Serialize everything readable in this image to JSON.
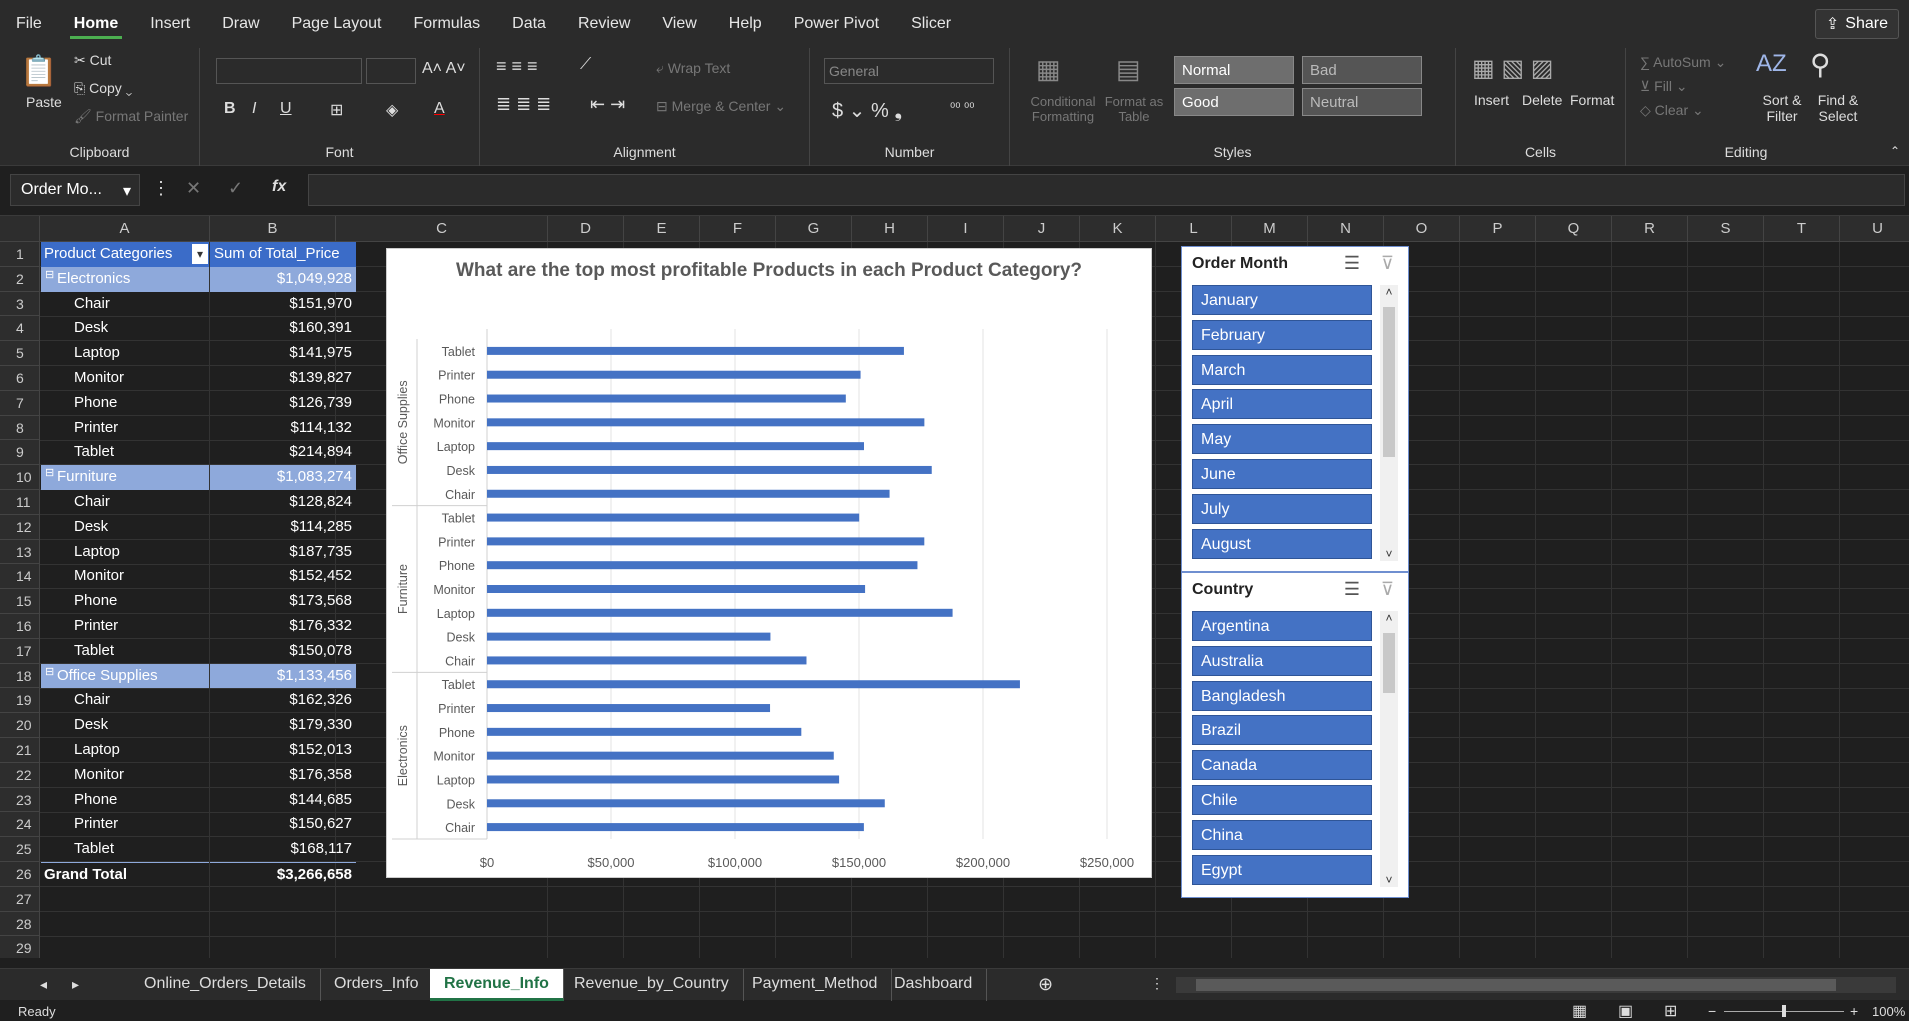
{
  "menu": {
    "items": [
      "File",
      "Home",
      "Insert",
      "Draw",
      "Page Layout",
      "Formulas",
      "Data",
      "Review",
      "View",
      "Help",
      "Power Pivot",
      "Slicer"
    ],
    "share": "Share"
  },
  "ribbon": {
    "clipboard": {
      "paste": "Paste",
      "cut": "Cut",
      "copy": "Copy",
      "format_painter": "Format Painter",
      "label": "Clipboard"
    },
    "font": {
      "label": "Font"
    },
    "alignment": {
      "wrap": "Wrap Text",
      "merge": "Merge & Center",
      "label": "Alignment"
    },
    "number": {
      "format": "General",
      "label": "Number"
    },
    "styles": {
      "conditional": "Conditional Formatting",
      "format_table": "Format as Table",
      "normal": "Normal",
      "bad": "Bad",
      "good": "Good",
      "neutral": "Neutral",
      "label": "Styles"
    },
    "cells": {
      "insert": "Insert",
      "delete": "Delete",
      "format": "Format",
      "label": "Cells"
    },
    "editing": {
      "autosum": "AutoSum",
      "fill": "Fill",
      "clear": "Clear",
      "sort": "Sort & Filter",
      "find": "Find & Select",
      "label": "Editing"
    }
  },
  "formula_bar": {
    "name_box": "Order Mo...",
    "fx": "fx"
  },
  "columns": [
    "A",
    "B",
    "C",
    "D",
    "E",
    "F",
    "G",
    "H",
    "I",
    "J",
    "K",
    "L",
    "M",
    "N",
    "O",
    "P",
    "Q",
    "R",
    "S",
    "T",
    "U"
  ],
  "rows": [
    "1",
    "2",
    "3",
    "4",
    "5",
    "6",
    "7",
    "8",
    "9",
    "10",
    "11",
    "12",
    "13",
    "14",
    "15",
    "16",
    "17",
    "18",
    "19",
    "20",
    "21",
    "22",
    "23",
    "24",
    "25",
    "26",
    "27",
    "28",
    "29"
  ],
  "pivot": {
    "header_a": "Product Categories",
    "header_b": "Sum of Total_Price",
    "groups": [
      {
        "name": "Electronics",
        "total": "$1,049,928",
        "items": [
          [
            "Chair",
            "$151,970"
          ],
          [
            "Desk",
            "$160,391"
          ],
          [
            "Laptop",
            "$141,975"
          ],
          [
            "Monitor",
            "$139,827"
          ],
          [
            "Phone",
            "$126,739"
          ],
          [
            "Printer",
            "$114,132"
          ],
          [
            "Tablet",
            "$214,894"
          ]
        ]
      },
      {
        "name": "Furniture",
        "total": "$1,083,274",
        "items": [
          [
            "Chair",
            "$128,824"
          ],
          [
            "Desk",
            "$114,285"
          ],
          [
            "Laptop",
            "$187,735"
          ],
          [
            "Monitor",
            "$152,452"
          ],
          [
            "Phone",
            "$173,568"
          ],
          [
            "Printer",
            "$176,332"
          ],
          [
            "Tablet",
            "$150,078"
          ]
        ]
      },
      {
        "name": "Office Supplies",
        "total": "$1,133,456",
        "items": [
          [
            "Chair",
            "$162,326"
          ],
          [
            "Desk",
            "$179,330"
          ],
          [
            "Laptop",
            "$152,013"
          ],
          [
            "Monitor",
            "$176,358"
          ],
          [
            "Phone",
            "$144,685"
          ],
          [
            "Printer",
            "$150,627"
          ],
          [
            "Tablet",
            "$168,117"
          ]
        ]
      }
    ],
    "grand_label": "Grand Total",
    "grand_total": "$3,266,658"
  },
  "chart_data": {
    "type": "bar",
    "title": "What are the top most profitable Products in each Product Category?",
    "groups": [
      {
        "name": "Office Supplies",
        "categories": [
          "Tablet",
          "Printer",
          "Phone",
          "Monitor",
          "Laptop",
          "Desk",
          "Chair"
        ],
        "values": [
          168117,
          150627,
          144685,
          176358,
          152013,
          179330,
          162326
        ]
      },
      {
        "name": "Furniture",
        "categories": [
          "Tablet",
          "Printer",
          "Phone",
          "Monitor",
          "Laptop",
          "Desk",
          "Chair"
        ],
        "values": [
          150078,
          176332,
          173568,
          152452,
          187735,
          114285,
          128824
        ]
      },
      {
        "name": "Electronics",
        "categories": [
          "Tablet",
          "Printer",
          "Phone",
          "Monitor",
          "Laptop",
          "Desk",
          "Chair"
        ],
        "values": [
          214894,
          114132,
          126739,
          139827,
          141975,
          160391,
          151970
        ]
      }
    ],
    "xticks": [
      "$0",
      "$50,000",
      "$100,000",
      "$150,000",
      "$200,000",
      "$250,000"
    ],
    "xlim": [
      0,
      250000
    ],
    "color": "#4472c4"
  },
  "slicers": {
    "month": {
      "title": "Order Month",
      "items": [
        "January",
        "February",
        "March",
        "April",
        "May",
        "June",
        "July",
        "August"
      ]
    },
    "country": {
      "title": "Country",
      "items": [
        "Argentina",
        "Australia",
        "Bangladesh",
        "Brazil",
        "Canada",
        "Chile",
        "China",
        "Egypt"
      ]
    }
  },
  "sheets": {
    "tabs": [
      "Online_Orders_Details",
      "Orders_Info",
      "Revenue_Info",
      "Revenue_by_Country",
      "Payment_Method",
      "Dashboard"
    ],
    "active": "Revenue_Info"
  },
  "status": {
    "ready": "Ready",
    "zoom": "100%"
  }
}
